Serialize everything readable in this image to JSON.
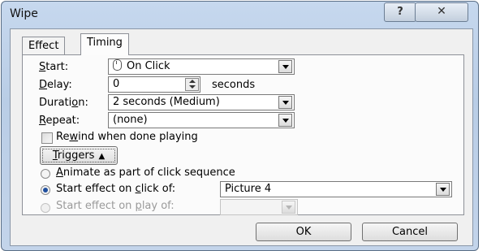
{
  "window": {
    "title": "Wipe",
    "help_label": "?",
    "close_label": "✕"
  },
  "tabs": [
    {
      "label": "Effect"
    },
    {
      "label": "Timing"
    }
  ],
  "fields": {
    "start": {
      "label_u": "S",
      "label_rest": "tart:",
      "value": "On Click",
      "icon": "mouse-icon"
    },
    "delay": {
      "label_u": "D",
      "label_rest": "elay:",
      "value": "0",
      "unit": "seconds"
    },
    "duration": {
      "label_pre": "Durati",
      "label_u": "o",
      "label_rest": "n:",
      "value": "2 seconds (Medium)"
    },
    "repeat": {
      "label_u": "R",
      "label_rest": "epeat:",
      "value": "(none)"
    }
  },
  "rewind": {
    "label_pre": "Re",
    "label_u": "w",
    "label_rest": "ind when done playing",
    "checked": false
  },
  "triggers": {
    "label_u": "T",
    "label_rest": "riggers",
    "chevron": "▲"
  },
  "options": [
    {
      "label_u": "A",
      "label_rest": "nimate as part of click sequence",
      "selected": false
    },
    {
      "label_pre": "Start effect on ",
      "label_u": "c",
      "label_rest": "lick of:",
      "selected": true,
      "value": "Picture 4"
    },
    {
      "label_pre": "Start effect on ",
      "label_u": "p",
      "label_rest": "lay of:",
      "selected": false,
      "disabled": true,
      "value": ""
    }
  ],
  "buttons": {
    "ok": "OK",
    "cancel": "Cancel"
  }
}
